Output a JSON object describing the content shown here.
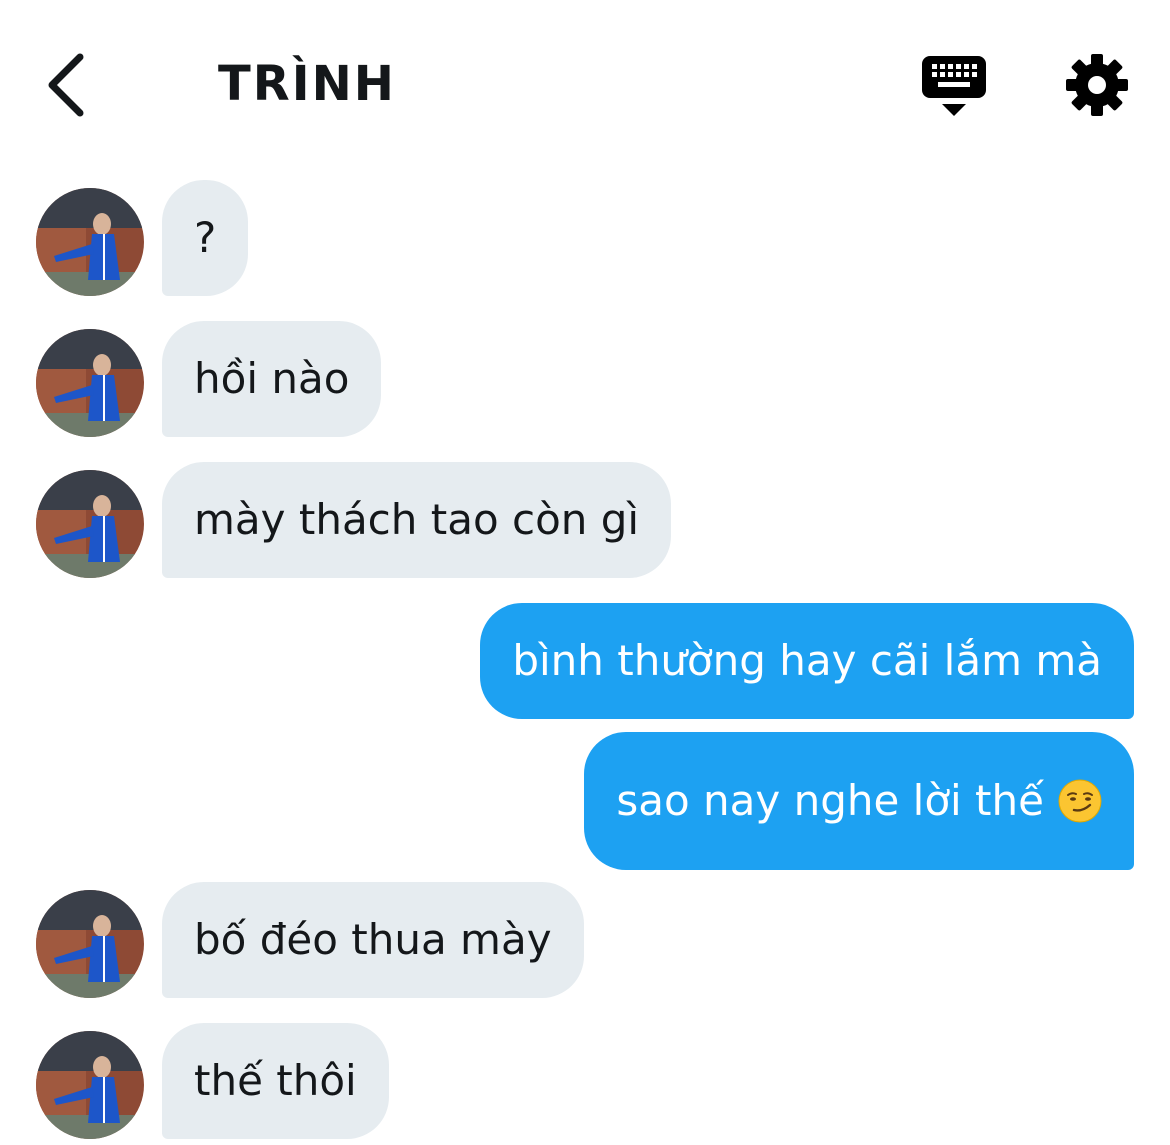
{
  "header": {
    "back_icon": "chevron-left-icon",
    "title": "TRÌNH",
    "keyboard_icon": "keyboard-icon",
    "settings_icon": "gear-icon"
  },
  "colors": {
    "incoming_bubble": "#e6ecf0",
    "outgoing_bubble": "#1da1f2",
    "text_dark": "#14171a",
    "text_light": "#ffffff"
  },
  "messages": [
    {
      "direction": "incoming",
      "text": "?"
    },
    {
      "direction": "incoming",
      "text": "hồi nào"
    },
    {
      "direction": "incoming",
      "text": "mày thách tao còn gì"
    },
    {
      "direction": "outgoing",
      "text": "bình thường hay cãi lắm mà"
    },
    {
      "direction": "outgoing",
      "text": "sao nay nghe lời thế",
      "emoji": "smirk-emoji"
    },
    {
      "direction": "incoming",
      "text": "bố đéo thua mày"
    },
    {
      "direction": "incoming",
      "text": "thế thôi"
    }
  ]
}
